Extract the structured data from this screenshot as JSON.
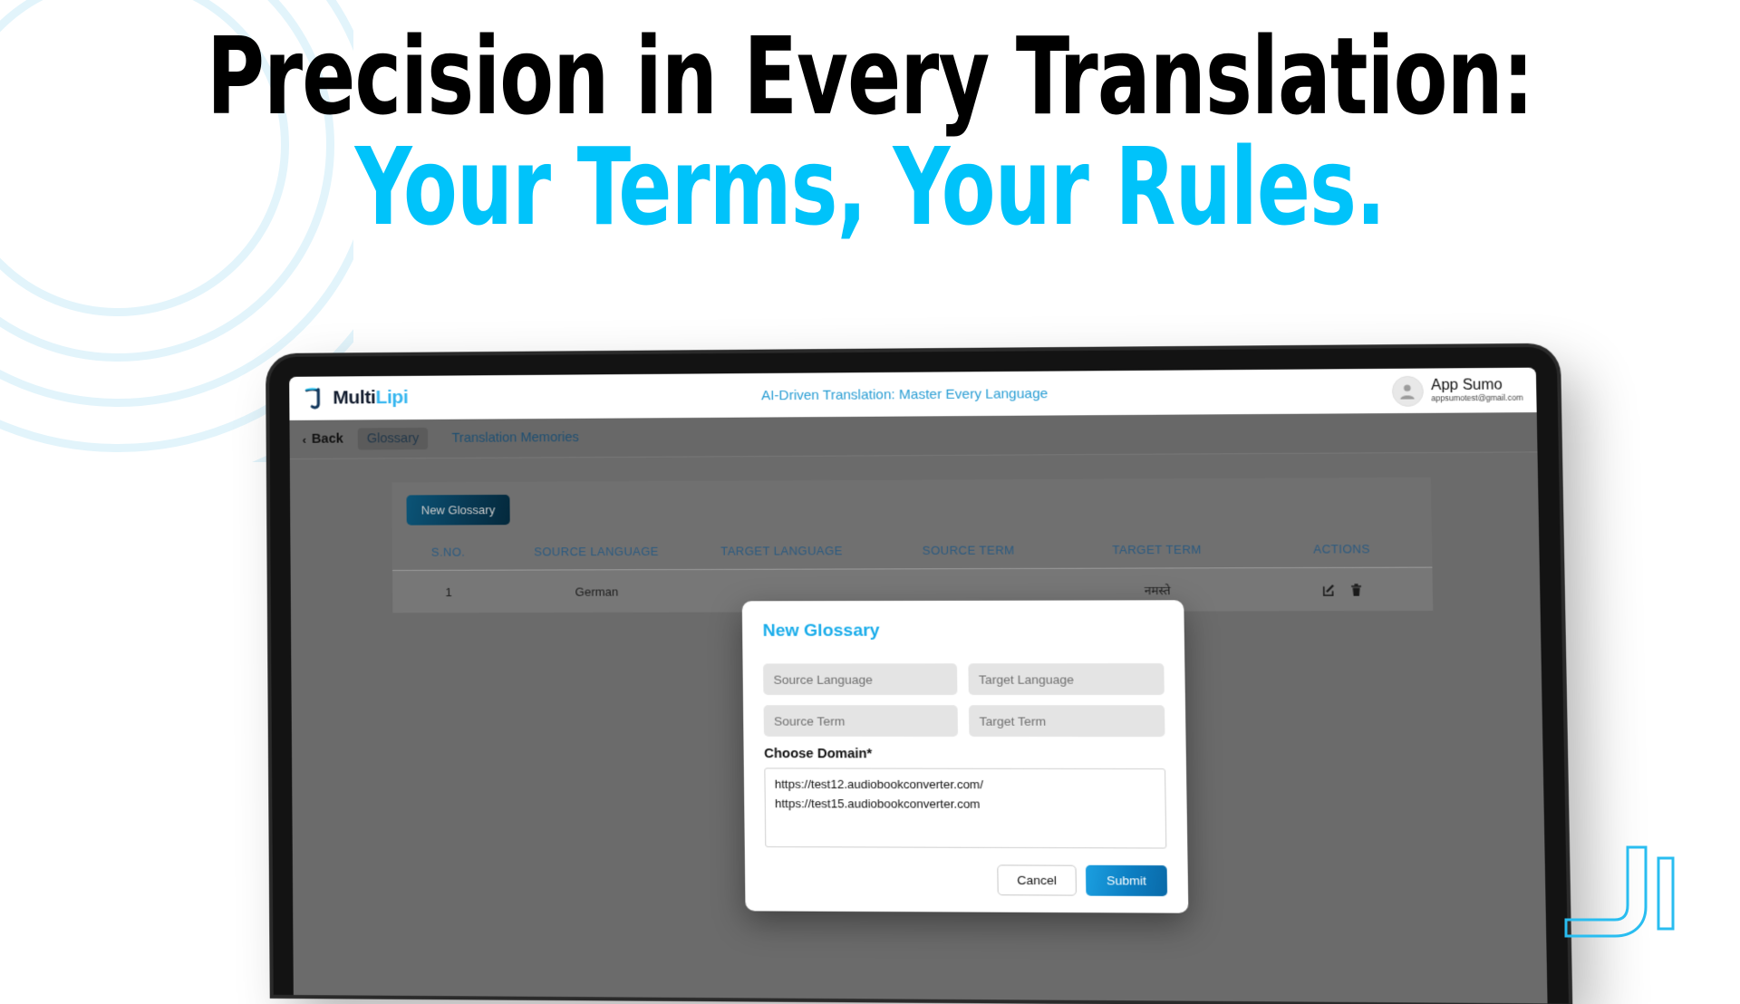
{
  "hero": {
    "line1": "Precision in Every Translation:",
    "line2": "Your Terms, Your Rules.",
    "color_line1": "#000000",
    "color_line2": "#00c3fa"
  },
  "app": {
    "logo": {
      "part1": "Multi",
      "part2": "Lipi",
      "icon": "multilipi-logo-icon"
    },
    "header_title": "AI-Driven Translation: Master Every Language",
    "header_title_color": "#2a9ed4",
    "profile": {
      "name": "App Sumo",
      "email": "appsumotest@gmail.com",
      "avatar_icon": "user-avatar-icon"
    },
    "nav": {
      "back_label": "Back",
      "back_icon": "chevron-left-icon",
      "tabs": [
        {
          "label": "Glossary",
          "active": true
        },
        {
          "label": "Translation Memories",
          "active": false
        }
      ]
    },
    "toolbar": {
      "new_glossary_label": "New Glossary"
    },
    "table": {
      "columns": [
        "S.NO.",
        "SOURCE LANGUAGE",
        "TARGET LANGUAGE",
        "SOURCE TERM",
        "TARGET TERM",
        "ACTIONS"
      ],
      "rows": [
        {
          "sno": "1",
          "source_language": "German",
          "target_language": "",
          "source_term": "",
          "target_term": "नमस्ते",
          "actions": [
            "edit-icon",
            "delete-icon"
          ]
        }
      ]
    },
    "modal": {
      "title": "New Glossary",
      "title_color": "#1badea",
      "fields": [
        {
          "name": "source-language-input",
          "placeholder": "Source Language",
          "value": ""
        },
        {
          "name": "target-language-input",
          "placeholder": "Target Language",
          "value": ""
        },
        {
          "name": "source-term-input",
          "placeholder": "Source Term",
          "value": ""
        },
        {
          "name": "target-term-input",
          "placeholder": "Target Term",
          "value": ""
        }
      ],
      "choose_domain_label": "Choose Domain*",
      "domains": [
        "https://test12.audiobookconverter.com/",
        "https://test15.audiobookconverter.com"
      ],
      "cancel_label": "Cancel",
      "submit_label": "Submit"
    }
  }
}
